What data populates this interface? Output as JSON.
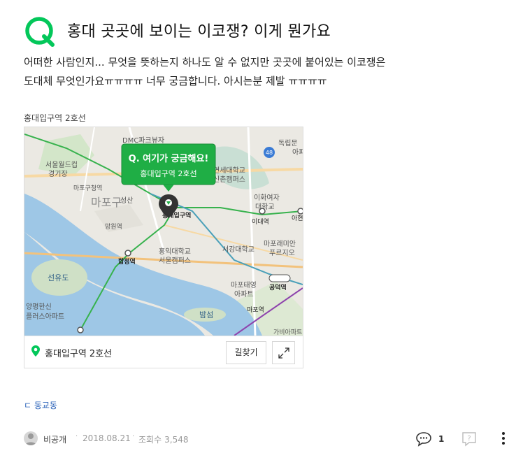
{
  "question": {
    "title": "홍대 곳곳에 보이는 이코쟁? 이게 뭔가요",
    "body_lines": [
      "어떠한 사람인지... 무엇을 뜻하는지 하나도 알 수 없지만 곳곳에 붙어있는 이코쟁은",
      "도대체 무엇인가요ㅠㅠㅠㅠ 너무 궁금합니다. 아시는분 제발 ㅠㅠㅠㅠ"
    ],
    "icon": "q-logo-icon",
    "accent_color": "#03c75a"
  },
  "map": {
    "caption": "홍대입구역 2호선",
    "callout_title": "Q. 여기가 궁금해요!",
    "callout_subtitle": "홍대입구역 2호선",
    "labels": {
      "dmc": "DMC파크뷰자",
      "worldcup1": "서울월드컵",
      "worldcup2": "경기장",
      "mapogu_office": "마포구청역",
      "mapogu": "마포구",
      "seongsan": "성산",
      "mangwon": "망원역",
      "yeonsei1": "연세대학교",
      "yeonsei2": "신촌캠퍼스",
      "ewha1": "이화여자",
      "ewha2": "대학교",
      "dokrip1": "독립문",
      "dokrip2": "아파",
      "hongdae_station": "홍대입구역",
      "ewha_station": "이대역",
      "ahyeon": "아현",
      "hongik1": "홍익대학교",
      "hongik2": "서울캠퍼스",
      "sogang": "서강대학교",
      "hapjeong": "합정역",
      "mapo_raemian1": "마포래미안",
      "mapo_raemian2": "푸르지오",
      "seonyudo": "선유도",
      "yangpyeong1": "양평한신",
      "yangpyeong2": "플러스아파트",
      "mapo_taeyeong1": "마포태영",
      "mapo_taeyeong2": "아파트",
      "gongdeok": "공덕역",
      "bamseom": "밤섬",
      "mapo_station": "마포역",
      "bottom_right": "가비아파트",
      "route48": "48"
    },
    "footer_label": "홍대입구역 2호선",
    "route_button": "길찾기",
    "expand_icon": "expand-icon",
    "pin_icon": "location-pin-icon"
  },
  "tag": {
    "label": "ㄷ 동교동"
  },
  "meta": {
    "author": "비공개",
    "separator": "·",
    "date": "2018.08.21",
    "views_label": "조회수",
    "views": "3,548"
  },
  "actions": {
    "comment_count": "1",
    "comment_icon": "comment-icon",
    "reply_icon": "question-reply-icon",
    "more_icon": "more-vertical-icon"
  }
}
